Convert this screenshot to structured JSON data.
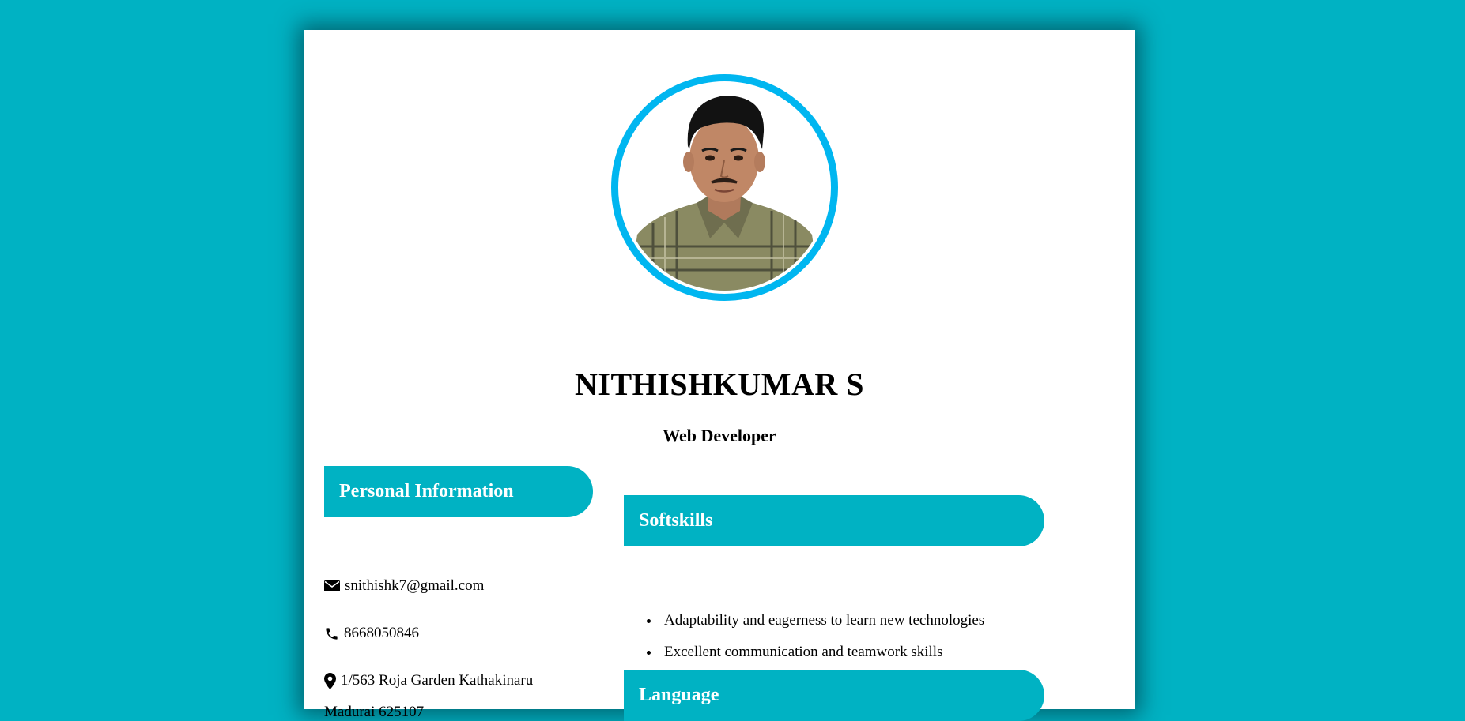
{
  "profile": {
    "name": "NITHISHKUMAR S",
    "title": "Web Developer"
  },
  "personal": {
    "heading": "Personal Information",
    "email": "snithishk7@gmail.com",
    "phone": "8668050846",
    "address_line1": "1/563 Roja Garden Kathakinaru",
    "address_line2": "Madurai 625107"
  },
  "softskills": {
    "heading": "Softskills",
    "items": [
      "Adaptability and eagerness to learn new technologies",
      "Excellent communication and teamwork skills"
    ]
  },
  "language": {
    "heading": "Language"
  },
  "icons": {
    "email": "envelope-icon",
    "phone": "phone-icon",
    "address": "map-marker-icon"
  },
  "colors": {
    "background": "#00b2c3",
    "banner": "#00b2c3",
    "photo_ring": "#00b6f0",
    "paper": "#ffffff"
  }
}
